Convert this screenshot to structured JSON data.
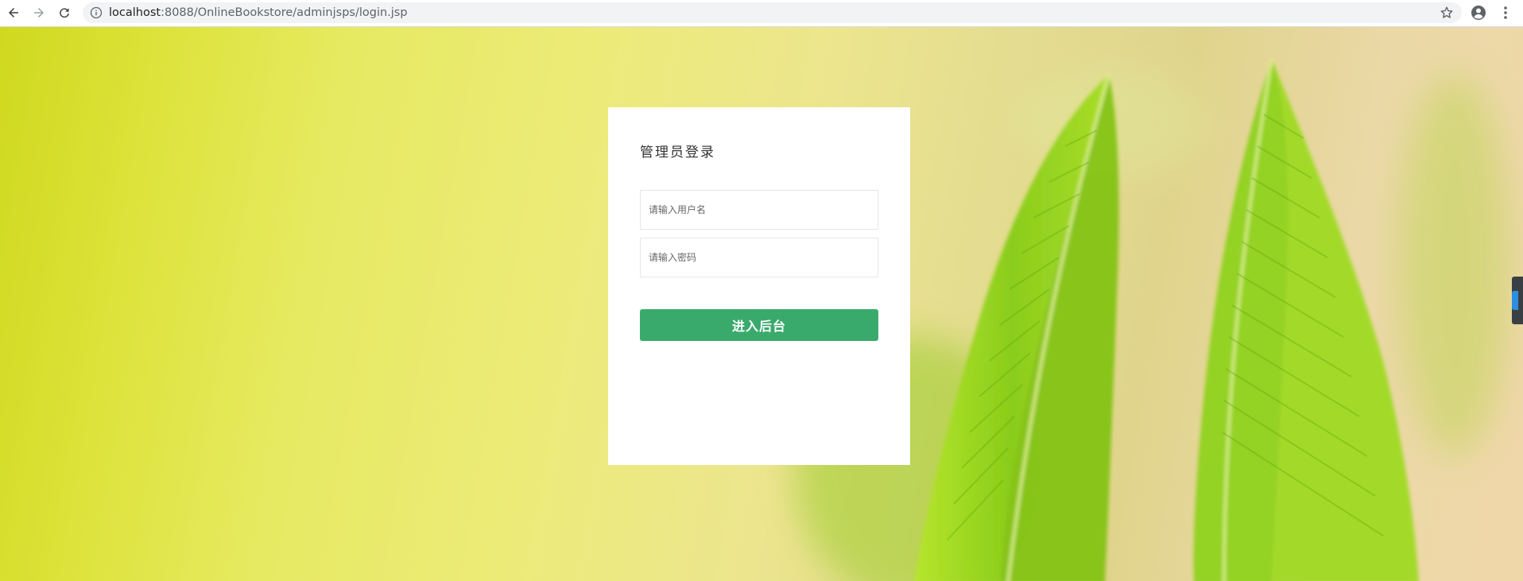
{
  "browser": {
    "url_host": "localhost",
    "url_rest": ":8088/OnlineBookstore/adminjsps/login.jsp",
    "icons": {
      "back": "back-arrow-icon",
      "forward": "forward-arrow-icon",
      "reload": "reload-icon",
      "info": "info-icon",
      "bookmark": "star-icon",
      "account": "account-icon",
      "menu": "kebab-menu-icon"
    }
  },
  "login": {
    "title": "管理员登录",
    "username_placeholder": "请输入用户名",
    "password_placeholder": "请输入密码",
    "submit_label": "进入后台"
  },
  "colors": {
    "button": "#3aaa6c",
    "card": "#ffffff",
    "leaf": "#8fd21a"
  }
}
